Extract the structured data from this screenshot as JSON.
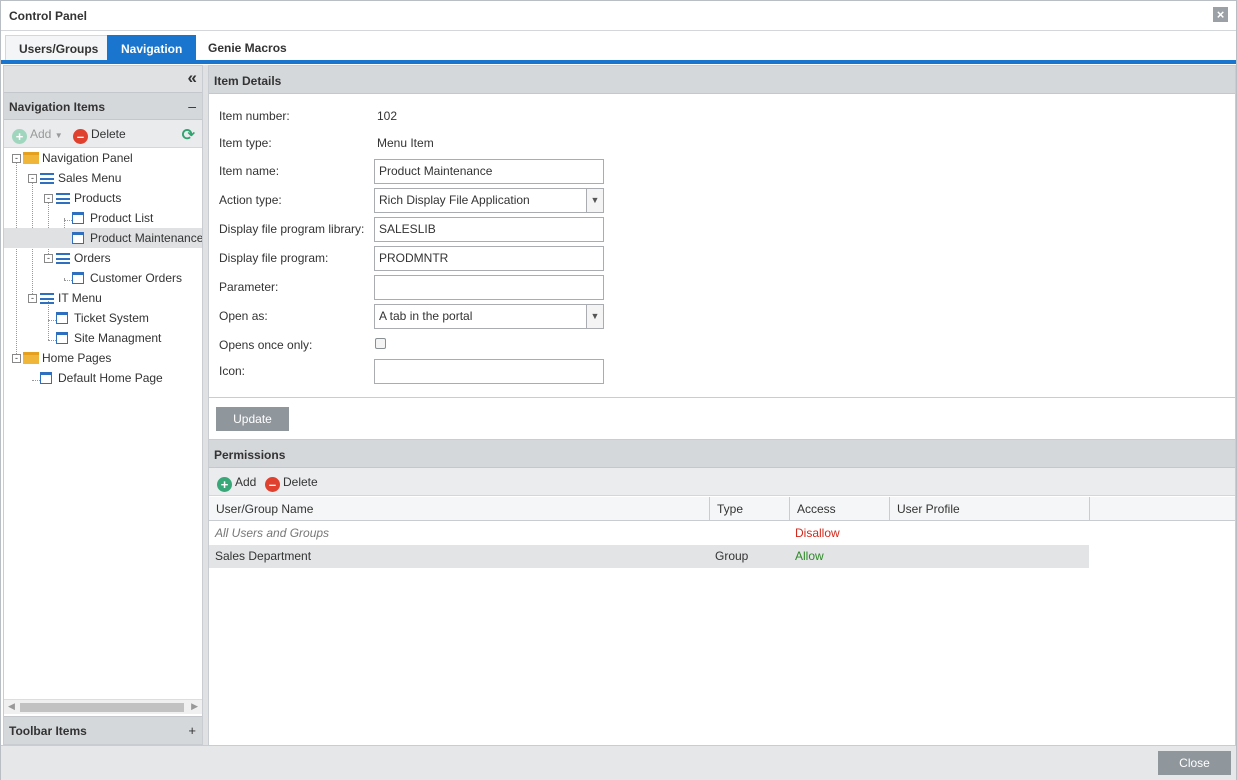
{
  "window": {
    "title": "Control Panel"
  },
  "tabs": [
    {
      "label": "Users/Groups",
      "active": false
    },
    {
      "label": "Navigation",
      "active": true
    },
    {
      "label": "Genie Macros",
      "active": false
    }
  ],
  "left": {
    "nav_header": "Navigation Items",
    "toolbar": {
      "add": "Add",
      "delete": "Delete"
    },
    "tree": [
      {
        "label": "Navigation Panel",
        "icon": "folder-icon"
      },
      {
        "label": "Sales Menu",
        "icon": "menu-list-icon"
      },
      {
        "label": "Products",
        "icon": "menu-list-icon"
      },
      {
        "label": "Product List",
        "icon": "window-page-icon"
      },
      {
        "label": "Product Maintenance",
        "icon": "window-page-icon",
        "selected": true
      },
      {
        "label": "Orders",
        "icon": "menu-list-icon"
      },
      {
        "label": "Customer Orders",
        "icon": "window-page-icon"
      },
      {
        "label": "IT Menu",
        "icon": "menu-list-icon"
      },
      {
        "label": "Ticket System",
        "icon": "window-page-icon"
      },
      {
        "label": "Site Managment",
        "icon": "window-page-icon"
      },
      {
        "label": "Home Pages",
        "icon": "folder-icon"
      },
      {
        "label": "Default Home Page",
        "icon": "window-page-icon"
      }
    ],
    "toolbar_header": "Toolbar Items"
  },
  "details": {
    "header": "Item Details",
    "fields": {
      "item_number": {
        "label": "Item number:",
        "value": "102"
      },
      "item_type": {
        "label": "Item type:",
        "value": "Menu Item"
      },
      "item_name": {
        "label": "Item name:",
        "value": "Product Maintenance"
      },
      "action_type": {
        "label": "Action type:",
        "value": "Rich Display File Application"
      },
      "library": {
        "label": "Display file program library:",
        "value": "SALESLIB"
      },
      "program": {
        "label": "Display file program:",
        "value": "PRODMNTR"
      },
      "parameter": {
        "label": "Parameter:",
        "value": ""
      },
      "open_as": {
        "label": "Open as:",
        "value": "A tab in the portal"
      },
      "opens_once": {
        "label": "Opens once only:",
        "checked": false
      },
      "icon": {
        "label": "Icon:",
        "value": ""
      }
    },
    "update_label": "Update"
  },
  "permissions": {
    "header": "Permissions",
    "toolbar": {
      "add": "Add",
      "delete": "Delete"
    },
    "columns": [
      "User/Group Name",
      "Type",
      "Access",
      "User Profile"
    ],
    "rows": [
      {
        "name": "All Users and Groups",
        "type": "",
        "access": "Disallow",
        "profile": ""
      },
      {
        "name": "Sales Department",
        "type": "Group",
        "access": "Allow",
        "profile": ""
      }
    ]
  },
  "footer": {
    "close_label": "Close"
  },
  "colors": {
    "accent": "#1a75cf",
    "allow": "#2d8a26",
    "disallow": "#d22a1d"
  }
}
